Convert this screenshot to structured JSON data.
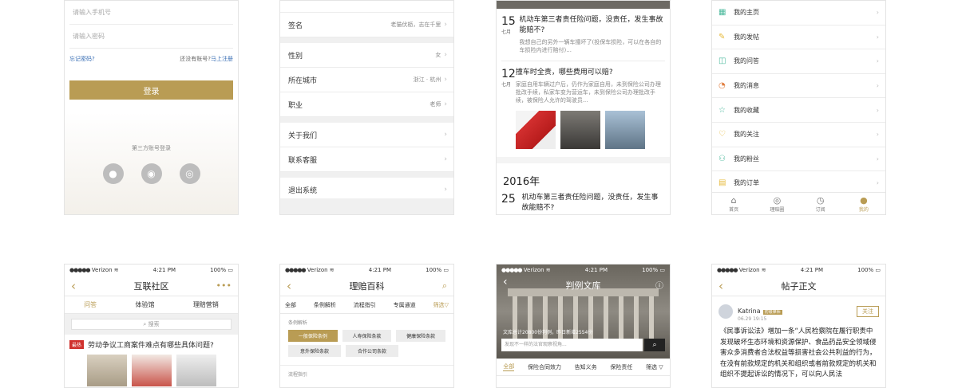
{
  "login": {
    "phone_placeholder": "请输入手机号",
    "password_placeholder": "请输入密码",
    "forgot": "忘记密码?",
    "no_account": "还没有账号?",
    "register": "马上注册",
    "login_button": "登录",
    "third_party": "第三方账号登录"
  },
  "settings": {
    "rows": [
      {
        "label": "签名",
        "value": "老猫伏枥，志在千里"
      },
      {
        "label": "性别",
        "value": "女"
      },
      {
        "label": "所在城市",
        "value": "浙江 · 杭州"
      },
      {
        "label": "职业",
        "value": "老师"
      },
      {
        "label": "关于我们",
        "value": ""
      },
      {
        "label": "联系客服",
        "value": ""
      },
      {
        "label": "退出系统",
        "value": ""
      }
    ]
  },
  "news": {
    "items": [
      {
        "day": "15",
        "month": "七月",
        "title": "机动车第三者责任险问题，没责任，发生事故能赔不?",
        "summary": "我想自己的另外一辆车撞坏了(投保车损险，可以在各自的车损险内进行赔付)..."
      },
      {
        "day": "12",
        "month": "七月",
        "title": "撞车时全责，哪些费用可以赔?",
        "summary": "家庭自用车辆过户后，仍作为家庭自用，未到保险公司办理批改手续，私家车变为营运车，未到保险公司办理批改手续，被保险人允许的驾驶员..."
      }
    ],
    "year": "2016年",
    "item3": {
      "day": "25",
      "title": "机动车第三者责任险问题，没责任，发生事故能赔不?"
    }
  },
  "profile": {
    "rows": [
      "我的主页",
      "我的发帖",
      "我的问答",
      "我的消息",
      "我的收藏",
      "我的关注",
      "我的粉丝",
      "我的订单"
    ],
    "tabs": [
      "首页",
      "理赔圈",
      "订阅",
      "我的"
    ]
  },
  "status": {
    "carrier": "Verizon",
    "time": "4:21 PM",
    "battery": "100%"
  },
  "community": {
    "title": "互联社区",
    "tabs": [
      "问答",
      "体验馆",
      "理赔营销"
    ],
    "search": "搜索",
    "badge": "最热",
    "question": "劳动争议工商案件难点有哪些具体问题?"
  },
  "wiki": {
    "title": "理赔百科",
    "cats": [
      "全部",
      "条例解析",
      "流程指引",
      "专属通道",
      "筛选"
    ],
    "section1": "条例解析",
    "tags": [
      "一般保险条例",
      "人寿保险条款",
      "健康保险条款",
      "意外保险条款",
      "合作公司条款"
    ],
    "section2": "流程指引"
  },
  "library": {
    "title": "判例文库",
    "stat": "文库总计20800份判例，昨日新增2554份",
    "search_placeholder": "发现不一样的法官观察视角...",
    "tabs": [
      "全部",
      "保险合同效力",
      "告知义务",
      "保险责任",
      "筛选"
    ]
  },
  "post": {
    "title": "帖子正文",
    "author": "Katrina",
    "level": "初级律师",
    "time": "06.29  19:15",
    "follow": "关注",
    "body": "《民事诉讼法》增加一条“人民检察院在履行职责中发现破坏生态环境和资源保护、食品药品安全领域侵害众多消费者合法权益等损害社会公共利益的行为，在没有前款规定的机关和组织或者前款规定的机关和组织不提起诉讼的情况下，可以向人民法"
  }
}
